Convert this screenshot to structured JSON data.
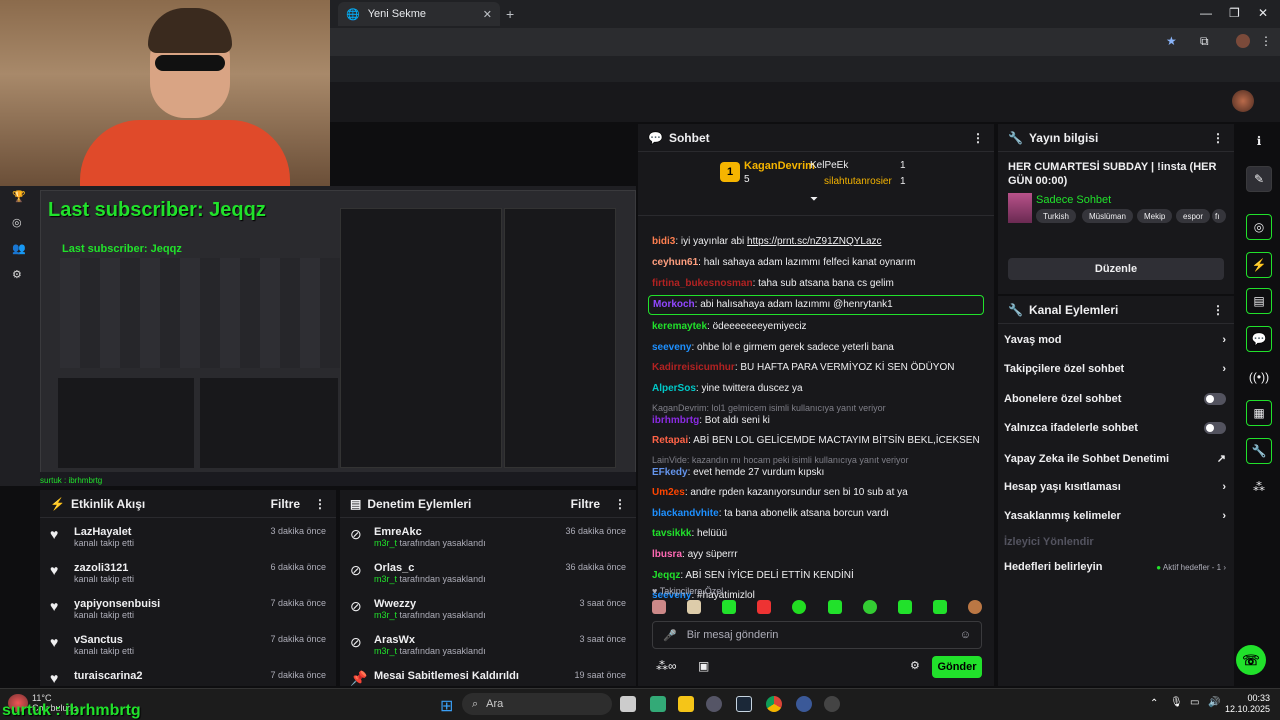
{
  "browser": {
    "tab_title": "Yeni Sekme"
  },
  "overlay": {
    "last_subscriber": "Last subscriber: Jeqqz",
    "last_subscriber_small": "Last subscriber: Jeqqz",
    "bottom_text": "surtuk : ibrhmbrtg",
    "bottom_text_small": "surtuk : ibrhmbrtg"
  },
  "activity": {
    "title": "Etkinlik Akışı",
    "filter": "Filtre",
    "items": [
      {
        "name": "LazHayalet",
        "sub": "kanalı takip etti",
        "time": "3 dakika önce"
      },
      {
        "name": "zazoli3121",
        "sub": "kanalı takip etti",
        "time": "6 dakika önce"
      },
      {
        "name": "yapiyonsenbuisi",
        "sub": "kanalı takip etti",
        "time": "7 dakika önce"
      },
      {
        "name": "vSanctus",
        "sub": "kanalı takip etti",
        "time": "7 dakika önce"
      },
      {
        "name": "turaiscarina2",
        "sub": "",
        "time": "7 dakika önce"
      }
    ]
  },
  "modlog": {
    "title": "Denetim Eylemleri",
    "filter": "Filtre",
    "items": [
      {
        "name": "EmreAkc",
        "by": "m3r_t",
        "sub": " tarafından yasaklandı",
        "time": "36 dakika önce"
      },
      {
        "name": "Orlas_c",
        "by": "m3r_t",
        "sub": " tarafından yasaklandı",
        "time": "36 dakika önce"
      },
      {
        "name": "Wwezzy",
        "by": "m3r_t",
        "sub": " tarafından yasaklandı",
        "time": "3 saat önce"
      },
      {
        "name": "ArasWx",
        "by": "m3r_t",
        "sub": " tarafından yasaklandı",
        "time": "3 saat önce"
      },
      {
        "name": "Mesai Sabitlemesi Kaldırıldı",
        "by": "",
        "sub": "",
        "time": "19 saat önce"
      }
    ]
  },
  "chat": {
    "title": "Sohbet",
    "leader_first": {
      "name": "KaganDevrim",
      "rank": "1",
      "count": "5"
    },
    "leader_second": {
      "name": "KelPeEk",
      "count": "1"
    },
    "leader_third": {
      "name": "silahtutanrosier",
      "count": "1"
    },
    "messages": [
      {
        "user": "bidi3",
        "color": "#ff7f50",
        "text": ": iyi yayınlar abi ",
        "link": "https://prnt.sc/nZ91ZNQYLazc"
      },
      {
        "user": "ceyhun61",
        "color": "#ff9f7f",
        "text": ": halı sahaya adam lazımmı felfeci kanat oynarım"
      },
      {
        "user": "firtina_bukesnosman",
        "color": "#b22222",
        "text": ": taha sub atsana bana cs gelim"
      },
      {
        "user": "Morkoch",
        "color": "#9147ff",
        "text": ": abi halısahaya adam lazımmı @henrytank1"
      },
      {
        "user": "keremaytek",
        "color": "#21e12b",
        "text": ": ödeeeeeeeyemiyeciz"
      },
      {
        "user": "seeveny",
        "color": "#1e90ff",
        "text": ": ohbe lol e girmem gerek sadece yeterli bana"
      },
      {
        "user": "Kadirreisicumhur",
        "color": "#b22222",
        "text": ": BU HAFTA PARA VERMİYOZ Kİ SEN ÖDÜYON"
      },
      {
        "user": "AlperSos",
        "color": "#00c8c8",
        "text": ": yine twittera duscez ya"
      },
      {
        "reply": "KaganDevrim: lol1 gelmicem isimli kullanıcıya yanıt veriyor"
      },
      {
        "user": "ibrhmbrtg",
        "color": "#8a2be2",
        "text": ": Bot aldı seni ki"
      },
      {
        "user": "Retapai",
        "color": "#ff6347",
        "text": ": ABİ BEN LOL GELİCEMDE MACTAYIM BİTSİN BEKL,İCEKSEN"
      },
      {
        "reply": "LainVide: kazandın mı hocam peki isimli kullanıcıya yanıt veriyor"
      },
      {
        "user": "EFkedy",
        "color": "#6495ed",
        "text": ": evet hemde 27 vurdum kıpskı"
      },
      {
        "user": "Um2es",
        "color": "#ff4500",
        "text": ": andre rpden kazanıyorsundur sen bi 10 sub at ya"
      },
      {
        "user": "blackandvhite",
        "color": "#1e90ff",
        "text": ": ta bana abonelik atsana borcun vardı"
      },
      {
        "user": "tavsikkk",
        "color": "#21e12b",
        "text": ": helüüü"
      },
      {
        "user": "lbusra",
        "color": "#ff69b4",
        "text": ": ayy süperrr"
      },
      {
        "user": "Jeqqz",
        "color": "#21e12b",
        "text": ": ABİ SEN İYİCE DELİ ETTİN KENDİNİ"
      },
      {
        "user": "seeveny",
        "color": "#1e90ff",
        "text": ": #hayatimizlol"
      }
    ],
    "followers_only": "Takipçilere Özel",
    "input_placeholder": "Bir mesaj gönderin",
    "send": "Gönder"
  },
  "info": {
    "title": "Yayın bilgisi",
    "stream_title": "HER CUMARTESİ SUBDAY | !insta (HER GÜN 00:00)",
    "category": "Sadece Sohbet",
    "tags": [
      "Turkish",
      "Müslüman",
      "Mekip",
      "espor",
      "fı"
    ],
    "edit": "Düzenle"
  },
  "actions": {
    "title": "Kanal Eylemleri",
    "items": [
      {
        "label": "Yavaş mod"
      },
      {
        "label": "Takipçilere özel sohbet"
      },
      {
        "label": "Abonelere özel sohbet"
      },
      {
        "label": "Yalnızca ifadelerle sohbet"
      },
      {
        "label": "Yapay Zeka ile Sohbet Denetimi"
      },
      {
        "label": "Hesap yaşı kısıtlaması"
      },
      {
        "label": "Yasaklanmış kelimeler"
      },
      {
        "label": "İzleyici Yönlendir"
      },
      {
        "label": "Hedefleri belirleyin"
      }
    ],
    "goals_status": "Aktif hedefler - 1"
  },
  "taskbar": {
    "search": "Ara",
    "weather_temp": "11°C",
    "weather_desc": "Çok bulutlu",
    "time": "00:33",
    "date": "12.10.2025"
  },
  "colors": {
    "accent": "#21e12b",
    "bg": "#0e0e10",
    "panel": "#18181b"
  }
}
